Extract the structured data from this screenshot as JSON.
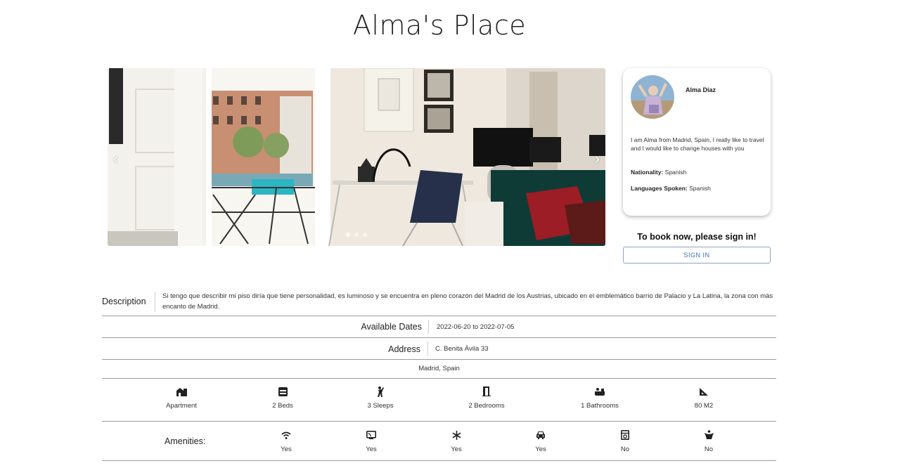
{
  "page": {
    "title": "Alma's Place"
  },
  "carousel": {
    "prev_label": "‹",
    "next_label": "›",
    "slide_count": 3,
    "active_slide": 1
  },
  "host": {
    "name": "Alma Diaz",
    "bio": "I am Alma from Madrid, Spain, I really like to travel and I would like to change houses with you",
    "nationality_label": "Nationality:",
    "nationality": "Spanish",
    "languages_label": "Languages Spoken:",
    "languages": "Spanish"
  },
  "booking": {
    "prompt": "To book now, please sign in!",
    "signin_label": "SIGN IN"
  },
  "details": {
    "description_label": "Description",
    "description": "Si tengo que describir mi piso diría que tiene personalidad, es luminoso y se encuentra en pleno corazón del Madrid de los Austrias, ubicado en el emblemático barrio de Palacio y La Latina, la zona con más encanto de Madrid.",
    "dates_label": "Available Dates",
    "dates": "2022-06-20 to 2022-07-05",
    "address_label": "Address",
    "address": "C. Benita Ávila 33",
    "city": "Madrid, Spain"
  },
  "features": [
    {
      "icon": "apartment-icon",
      "label": "Apartment"
    },
    {
      "icon": "bed-icon",
      "label": "2 Beds"
    },
    {
      "icon": "person-icon",
      "label": "3 Sleeps"
    },
    {
      "icon": "door-icon",
      "label": "2 Bedrooms"
    },
    {
      "icon": "bathtub-icon",
      "label": "1 Bathrooms"
    },
    {
      "icon": "area-icon",
      "label": "80 M2"
    }
  ],
  "amenities": {
    "label": "Amenities:",
    "items": [
      {
        "icon": "wifi-icon",
        "value": "Yes"
      },
      {
        "icon": "tv-icon",
        "value": "Yes"
      },
      {
        "icon": "snowflake-icon",
        "value": "Yes"
      },
      {
        "icon": "car-icon",
        "value": "Yes"
      },
      {
        "icon": "washer-icon",
        "value": "No"
      },
      {
        "icon": "pet-icon",
        "value": "No"
      }
    ]
  }
}
